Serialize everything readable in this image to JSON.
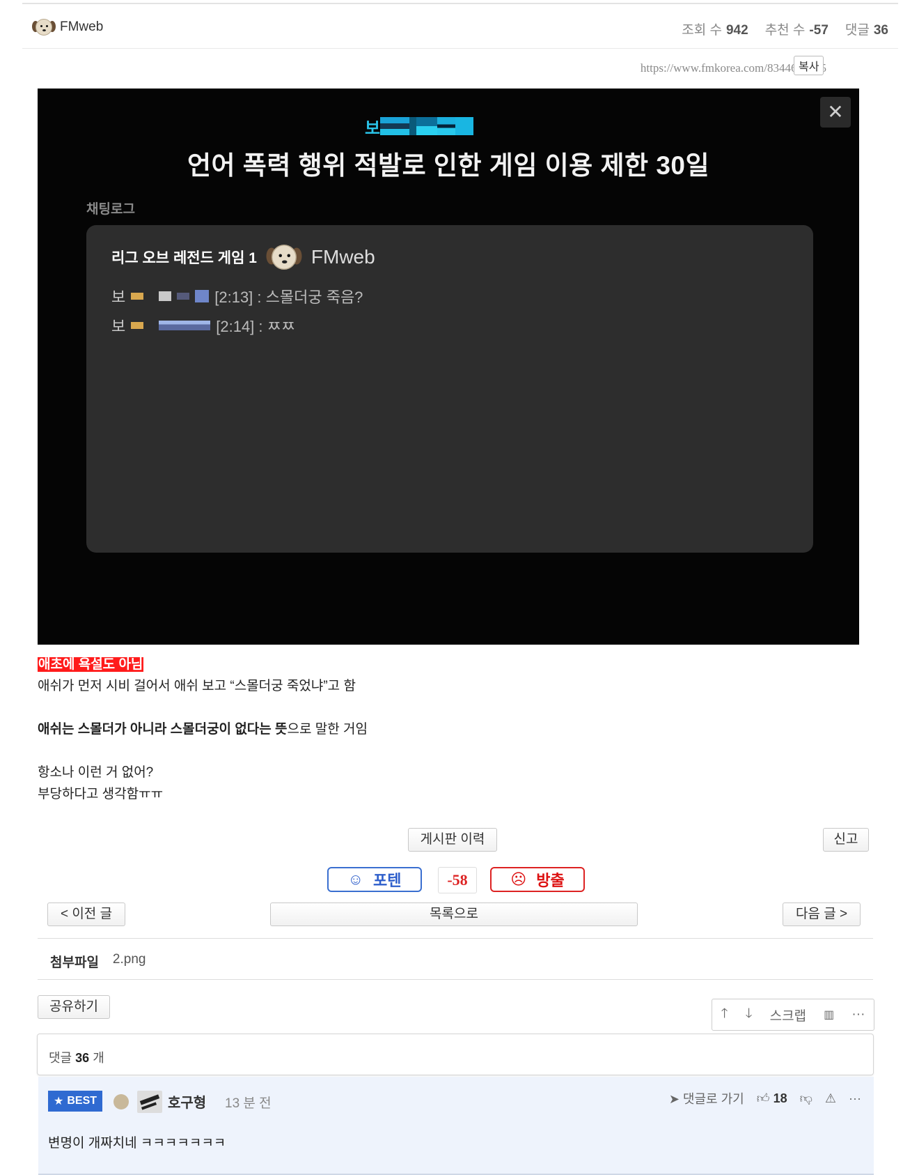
{
  "header": {
    "author": "FMweb",
    "views_label": "조회 수",
    "views": "942",
    "recommend_label": "추천 수",
    "recommend": "-57",
    "comments_label": "댓글",
    "comments": "36"
  },
  "url": {
    "text": "https://www.fmkorea.com/8344620575",
    "copy_label": "복사"
  },
  "screenshot": {
    "game_prefix": "보",
    "headline": "언어 폭력 행위 적발로 인한 게임 이용 제한 30일",
    "chat_label": "채팅로그",
    "chat_title": "리그 오브 레전드 게임 1",
    "chat_user": "FMweb",
    "lines": [
      {
        "prefix": "보",
        "stamp": "[2:13] : 스몰더궁 죽음?"
      },
      {
        "prefix": "보",
        "stamp": "[2:14] : ㅉㅉ"
      }
    ],
    "colors": {
      "bg": "#050505",
      "chatbox": "#2d2d2d",
      "accent": "#2ac3e8"
    }
  },
  "post": {
    "highlight": "애초에 욕설도 아님",
    "line1": "애쉬가 먼저 시비 걸어서 애쉬 보고 “스몰더궁 죽었냐”고 함",
    "line2_bold": "애쉬는 스몰더가 아니라 스몰더궁이 없다는 뜻",
    "line2_rest": "으로 말한 거임",
    "line3": "항소나 이런 거 없어?",
    "line4": "부당하다고 생각함ㅠㅠ"
  },
  "buttons": {
    "board_history": "게시판 이력",
    "report": "신고",
    "vote_up": "포텐",
    "vote_score": "-58",
    "vote_down": "방출",
    "prev": "< 이전 글",
    "list": "목록으로",
    "next": "다음 글 >",
    "share": "공유하기"
  },
  "attachment": {
    "label": "첨부파일",
    "file": "2.png"
  },
  "toolbar": {
    "up_icon": "arrow-up-icon",
    "down_icon": "arrow-down-icon",
    "scrap": "스크랩",
    "stats_icon": "bar-chart-icon",
    "more_icon": "more-icon"
  },
  "comments": {
    "count_prefix": "댓글",
    "count": "36",
    "count_suffix": "개",
    "best": {
      "badge": "BEST",
      "nick": "호구형",
      "time": "13 분 전",
      "goto": "댓글로 가기",
      "likes": "18",
      "text": "변명이 개짜치네 ㅋㅋㅋㅋㅋㅋㅋ"
    }
  }
}
